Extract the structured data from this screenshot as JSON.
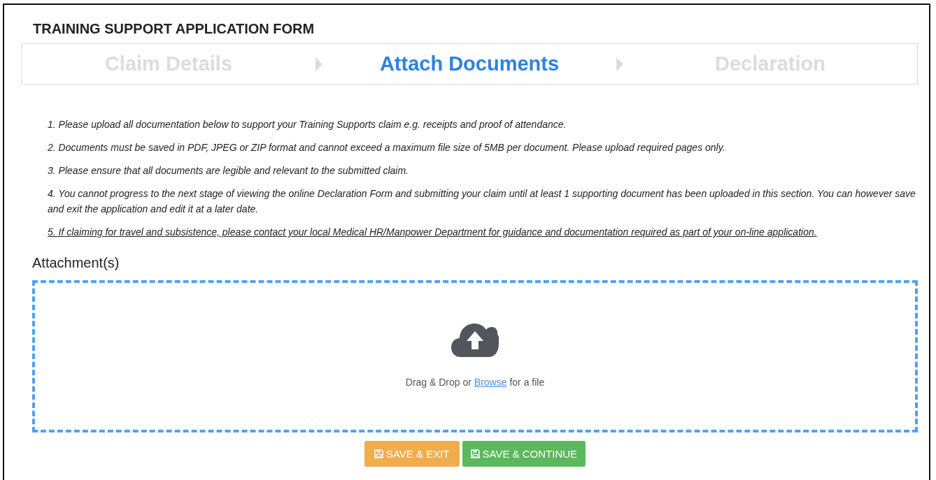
{
  "form_title": "TRAINING SUPPORT APPLICATION FORM",
  "steps": [
    {
      "label": "Claim Details",
      "selected": false
    },
    {
      "label": "Attach Documents",
      "selected": true
    },
    {
      "label": "Declaration",
      "selected": false
    }
  ],
  "instructions": [
    {
      "text": "1. Please upload all documentation below to support your Training Supports claim e.g. receipts and proof of attendance.",
      "underlined": false
    },
    {
      "text": "2. Documents must be saved in PDF, JPEG or ZIP format and cannot exceed a maximum file size of 5MB per document. Please upload required pages only.",
      "underlined": false
    },
    {
      "text": "3. Please ensure that all documents are legible and relevant to the submitted claim.",
      "underlined": false
    },
    {
      "text": "4. You cannot progress to the next stage of viewing the online Declaration Form and submitting your claim until at least 1 supporting document has been uploaded in this section. You can however save and exit the application and edit it at a later date.",
      "underlined": false
    },
    {
      "text": "5. If claiming for travel and subsistence, please contact your local Medical HR/Manpower Department for guidance and documentation required as part of your on-line application.",
      "underlined": true
    }
  ],
  "attachments": {
    "label": "Attachment(s)",
    "drop_text_before": "Drag & Drop or",
    "browse_link": "Browse",
    "drop_text_after": "for a file"
  },
  "buttons": [
    {
      "label": "SAVE & EXIT",
      "kind": "warning"
    },
    {
      "label": "SAVE & CONTINUE",
      "kind": "success"
    }
  ]
}
